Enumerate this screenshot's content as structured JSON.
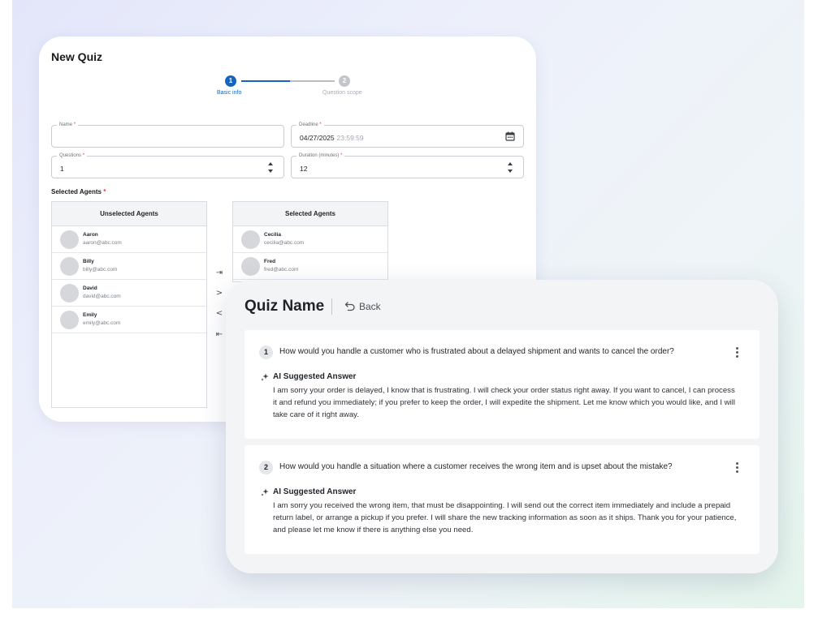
{
  "new_quiz": {
    "title": "New Quiz",
    "steps": [
      {
        "number": "1",
        "label": "Basic info",
        "state": "active"
      },
      {
        "number": "2",
        "label": "Question scope",
        "state": "inactive"
      }
    ],
    "fields": {
      "name": {
        "label": "Name",
        "required_mark": "*",
        "value": ""
      },
      "deadline": {
        "label": "Deadline",
        "required_mark": "*",
        "date": "04/27/2025",
        "time": "23:59:59"
      },
      "questions": {
        "label": "Questions",
        "required_mark": "*",
        "value": "1"
      },
      "duration": {
        "label": "Duration (minutes)",
        "required_mark": "*",
        "value": "12"
      }
    },
    "selected_agents_label": "Selected Agents",
    "selected_agents_required": "*",
    "unselected_list": {
      "header": "Unselected Agents",
      "agents": [
        {
          "name": "Aaron",
          "email": "aaron@abc.com"
        },
        {
          "name": "Billy",
          "email": "billy@abc.com"
        },
        {
          "name": "David",
          "email": "david@abc.com"
        },
        {
          "name": "Emily",
          "email": "emily@abc.com"
        }
      ]
    },
    "selected_list": {
      "header": "Selected Agents",
      "agents": [
        {
          "name": "Cecilia",
          "email": "cecilia@abc.com"
        },
        {
          "name": "Fred",
          "email": "fred@abc.com"
        }
      ]
    },
    "transfer_buttons": {
      "move_all_right": "⇥",
      "move_right": ">",
      "move_left": "<",
      "move_all_left": "⇤"
    }
  },
  "quiz_detail": {
    "title": "Quiz Name",
    "back_label": "Back",
    "ai_label": "AI Suggested Answer",
    "questions": [
      {
        "number": "1",
        "text": "How would you handle a customer who is frustrated about a delayed shipment and wants to cancel the order?",
        "answer": "I am sorry your order is delayed, I know that is frustrating. I will check your order status right away. If you want to cancel, I can process it and refund you immediately; if you prefer to keep the order, I will expedite the shipment. Let me know which you would like, and I will take care of it right away."
      },
      {
        "number": "2",
        "text": "How would you handle a situation where a customer receives the wrong item and is upset about the mistake?",
        "answer": "I am sorry you received the wrong item, that must be disappointing. I will send out the correct item immediately and include a prepaid return label, or arrange a pickup if you prefer. I will share the new tracking information as soon as it ships. Thank you for your patience, and please let me know if there is anything else you need."
      }
    ]
  },
  "colors": {
    "primary": "#1565c0",
    "required": "#e53935",
    "step_inactive": "#c2c6cc"
  }
}
